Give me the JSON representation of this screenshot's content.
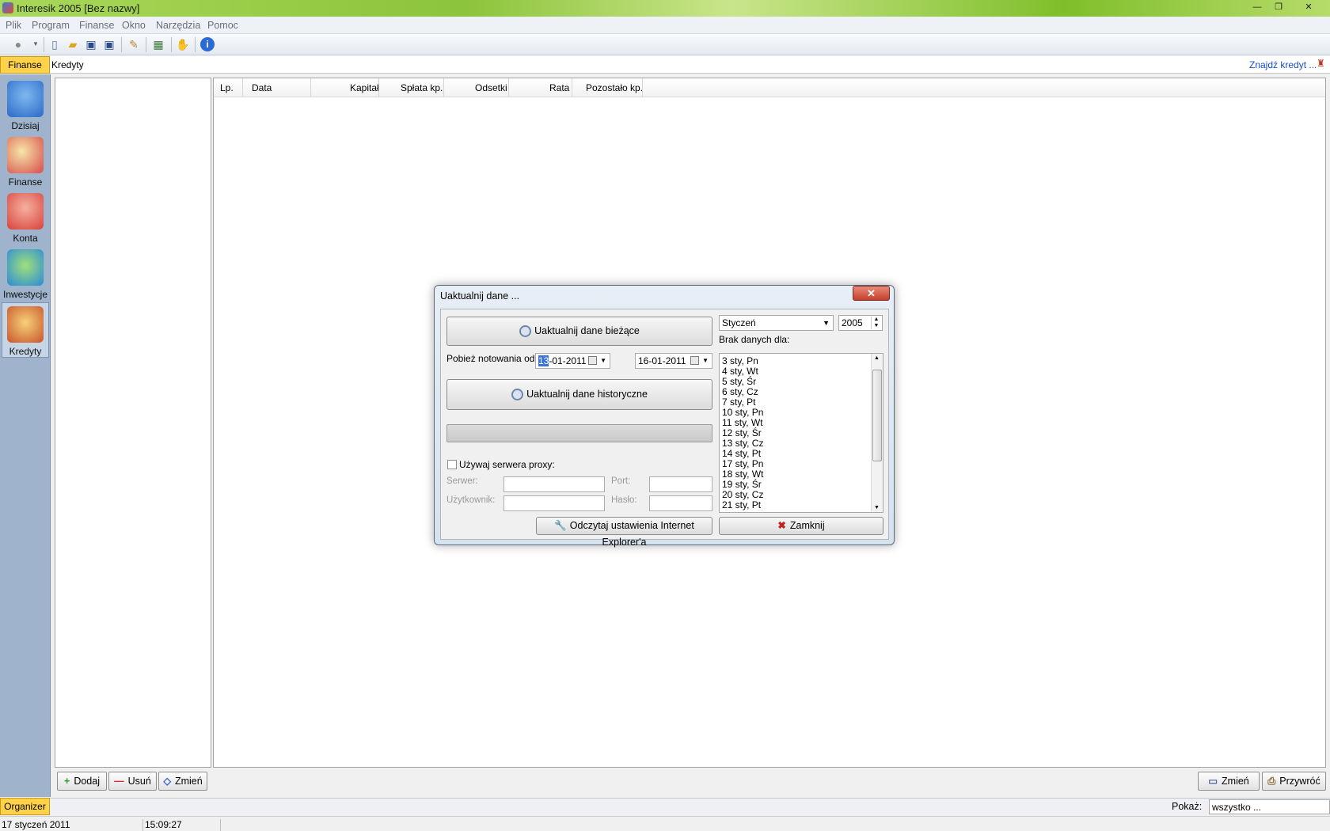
{
  "window": {
    "title": "Interesik 2005 [Bez nazwy]",
    "minimize": "—",
    "restore": "❐",
    "close": "✕"
  },
  "menu": [
    "Plik",
    "Program",
    "Finanse",
    "Okno",
    "Narzędzia",
    "Pomoc"
  ],
  "section": {
    "tab": "Finanse",
    "title": "Kredyty",
    "find_link": "Znajdź kredyt ..."
  },
  "sidebar": [
    {
      "label": "Dzisiaj",
      "icon": "house-icon",
      "color": "#4a8ad8"
    },
    {
      "label": "Finanse",
      "icon": "calculator-icon",
      "color": "#d84a4a"
    },
    {
      "label": "Konta",
      "icon": "gift-box-icon",
      "color": "#d8423a"
    },
    {
      "label": "Inwestycje",
      "icon": "globe-icon",
      "color": "#3a9ad8"
    },
    {
      "label": "Kredyty",
      "icon": "cart-icon",
      "color": "#e08a2a"
    }
  ],
  "grid": {
    "columns": [
      "Lp.",
      "Data",
      "Kapitał",
      "Spłata kp.",
      "Odsetki",
      "Rata",
      "Pozostało kp."
    ]
  },
  "buttons": {
    "add": "Dodaj",
    "remove": "Usuń",
    "edit": "Zmień",
    "change": "Zmień",
    "restore": "Przywróć"
  },
  "bottom": {
    "organizer_tab": "Organizer",
    "show_label": "Pokaż:",
    "show_value": "wszystko ..."
  },
  "status": {
    "date": "17 styczeń 2011",
    "time": "15:09:27"
  },
  "dialog": {
    "title": "Uaktualnij dane ...",
    "update_current": "Uaktualnij dane bieżące",
    "fetch_label": "Pobież notowania od:",
    "date_from_selected": "13",
    "date_from_rest": "-01-2011",
    "date_to": "16-01-2011",
    "update_history": "Uaktualnij dane historyczne",
    "proxy_label": "Używaj serwera proxy:",
    "server_label": "Serwer:",
    "port_label": "Port:",
    "user_label": "Użytkownik:",
    "password_label": "Hasło:",
    "read_ie": "Odczytaj ustawienia Internet Explorer'a",
    "close": "Zamknij",
    "month": "Styczeń",
    "year": "2005",
    "nodata_label": "Brak danych dla:",
    "nodata_items": [
      "3 sty, Pn",
      "4 sty, Wt",
      "5 sty, Śr",
      "6 sty, Cz",
      "7 sty, Pt",
      "10 sty, Pn",
      "11 sty, Wt",
      "12 sty, Śr",
      "13 sty, Cz",
      "14 sty, Pt",
      "17 sty, Pn",
      "18 sty, Wt",
      "19 sty, Śr",
      "20 sty, Cz",
      "21 sty, Pt"
    ]
  }
}
